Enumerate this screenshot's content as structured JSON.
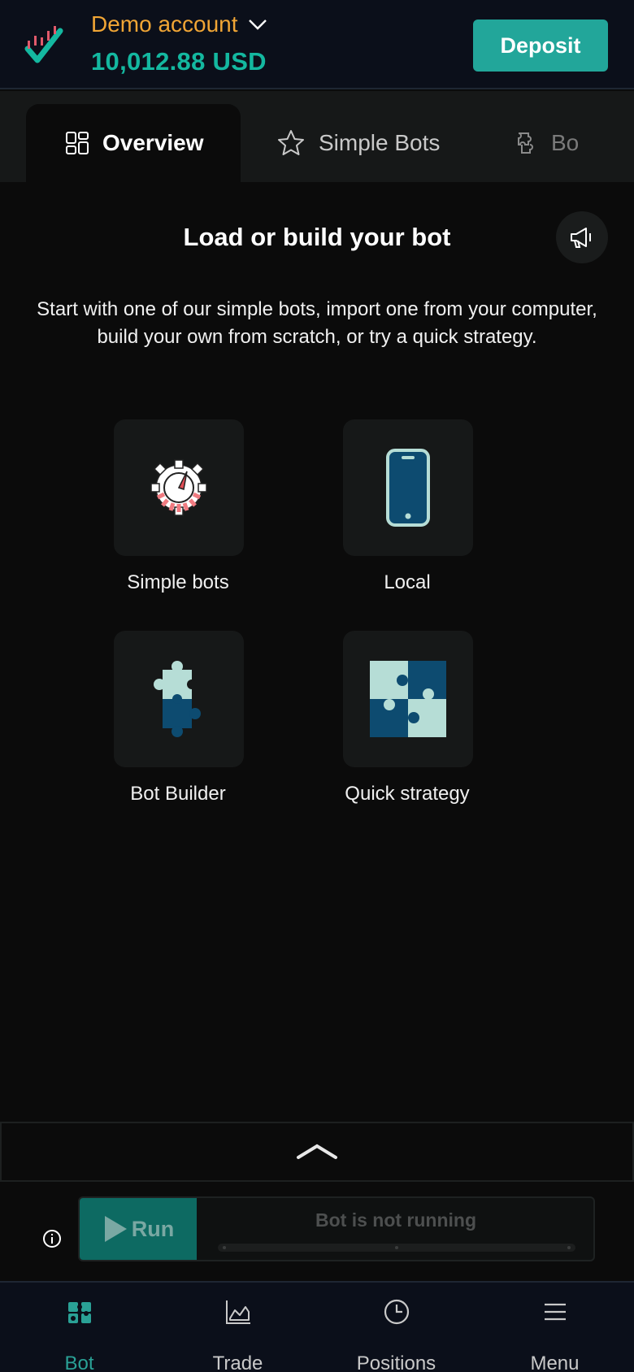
{
  "header": {
    "account_label": "Demo account",
    "balance": "10,012.88 USD",
    "deposit_label": "Deposit"
  },
  "tabs": [
    {
      "label": "Overview",
      "icon": "dashboard-icon",
      "active": true
    },
    {
      "label": "Simple Bots",
      "icon": "star-icon",
      "active": false
    },
    {
      "label": "Bo",
      "icon": "puzzle-icon",
      "active": false
    }
  ],
  "main": {
    "title": "Load or build your bot",
    "description": "Start with one of our simple bots, import one from your computer, build your own from scratch, or try a quick strategy.",
    "cards": [
      {
        "label": "Simple bots",
        "icon": "gear-speedometer-icon"
      },
      {
        "label": "Local",
        "icon": "phone-icon"
      },
      {
        "label": "Bot Builder",
        "icon": "puzzle-pieces-icon"
      },
      {
        "label": "Quick strategy",
        "icon": "puzzle-grid-icon"
      }
    ]
  },
  "run_panel": {
    "run_label": "Run",
    "status_text": "Bot is not running"
  },
  "bottom_nav": [
    {
      "label": "Bot",
      "icon": "bot-icon",
      "active": true
    },
    {
      "label": "Trade",
      "icon": "chart-icon",
      "active": false
    },
    {
      "label": "Positions",
      "icon": "clock-icon",
      "active": false
    },
    {
      "label": "Menu",
      "icon": "hamburger-icon",
      "active": false
    }
  ],
  "colors": {
    "accent": "#22a69a",
    "account_label": "#f0a535",
    "balance": "#14b8a0",
    "run_button": "#0d6a62"
  }
}
